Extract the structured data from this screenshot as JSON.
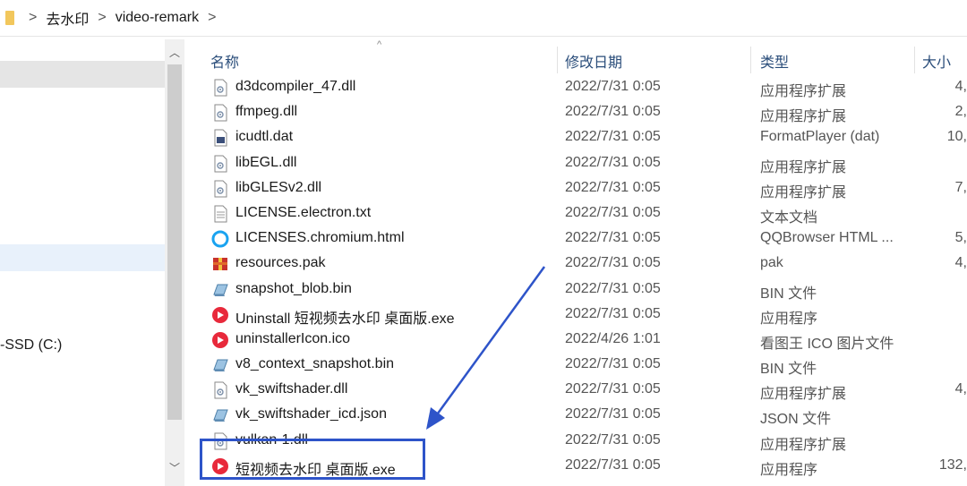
{
  "breadcrumb": {
    "items": [
      "去水印",
      "video-remark"
    ],
    "separator": ">"
  },
  "nav": {
    "drive_label": "-SSD (C:)"
  },
  "columns": {
    "name": "名称",
    "date": "修改日期",
    "type": "类型",
    "size": "大小"
  },
  "files": [
    {
      "name": "d3dcompiler_47.dll",
      "date": "2022/7/31 0:05",
      "type": "应用程序扩展",
      "size": "4,",
      "icon": "dll-icon"
    },
    {
      "name": "ffmpeg.dll",
      "date": "2022/7/31 0:05",
      "type": "应用程序扩展",
      "size": "2,",
      "icon": "dll-icon"
    },
    {
      "name": "icudtl.dat",
      "date": "2022/7/31 0:05",
      "type": "FormatPlayer (dat)",
      "size": "10,",
      "icon": "media-file-icon"
    },
    {
      "name": "libEGL.dll",
      "date": "2022/7/31 0:05",
      "type": "应用程序扩展",
      "size": "",
      "icon": "dll-icon"
    },
    {
      "name": "libGLESv2.dll",
      "date": "2022/7/31 0:05",
      "type": "应用程序扩展",
      "size": "7,",
      "icon": "dll-icon"
    },
    {
      "name": "LICENSE.electron.txt",
      "date": "2022/7/31 0:05",
      "type": "文本文档",
      "size": "",
      "icon": "text-file-icon"
    },
    {
      "name": "LICENSES.chromium.html",
      "date": "2022/7/31 0:05",
      "type": "QQBrowser HTML ...",
      "size": "5,",
      "icon": "qqbrowser-icon"
    },
    {
      "name": "resources.pak",
      "date": "2022/7/31 0:05",
      "type": "pak",
      "size": "4,",
      "icon": "archive-icon"
    },
    {
      "name": "snapshot_blob.bin",
      "date": "2022/7/31 0:05",
      "type": "BIN 文件",
      "size": "",
      "icon": "bin-file-icon"
    },
    {
      "name": "Uninstall 短视频去水印 桌面版.exe",
      "date": "2022/7/31 0:05",
      "type": "应用程序",
      "size": "",
      "icon": "app-icon"
    },
    {
      "name": "uninstallerIcon.ico",
      "date": "2022/4/26 1:01",
      "type": "看图王 ICO 图片文件",
      "size": "",
      "icon": "app-icon"
    },
    {
      "name": "v8_context_snapshot.bin",
      "date": "2022/7/31 0:05",
      "type": "BIN 文件",
      "size": "",
      "icon": "bin-file-icon"
    },
    {
      "name": "vk_swiftshader.dll",
      "date": "2022/7/31 0:05",
      "type": "应用程序扩展",
      "size": "4,",
      "icon": "dll-icon"
    },
    {
      "name": "vk_swiftshader_icd.json",
      "date": "2022/7/31 0:05",
      "type": "JSON 文件",
      "size": "",
      "icon": "bin-file-icon"
    },
    {
      "name": "vulkan-1.dll",
      "date": "2022/7/31 0:05",
      "type": "应用程序扩展",
      "size": "",
      "icon": "dll-icon"
    },
    {
      "name": "短视频去水印 桌面版.exe",
      "date": "2022/7/31 0:05",
      "type": "应用程序",
      "size": "132,",
      "icon": "app-icon"
    }
  ],
  "colors": {
    "accent": "#2e54c9",
    "header_text": "#2a4d7a",
    "app_icon": "#e8293b"
  }
}
